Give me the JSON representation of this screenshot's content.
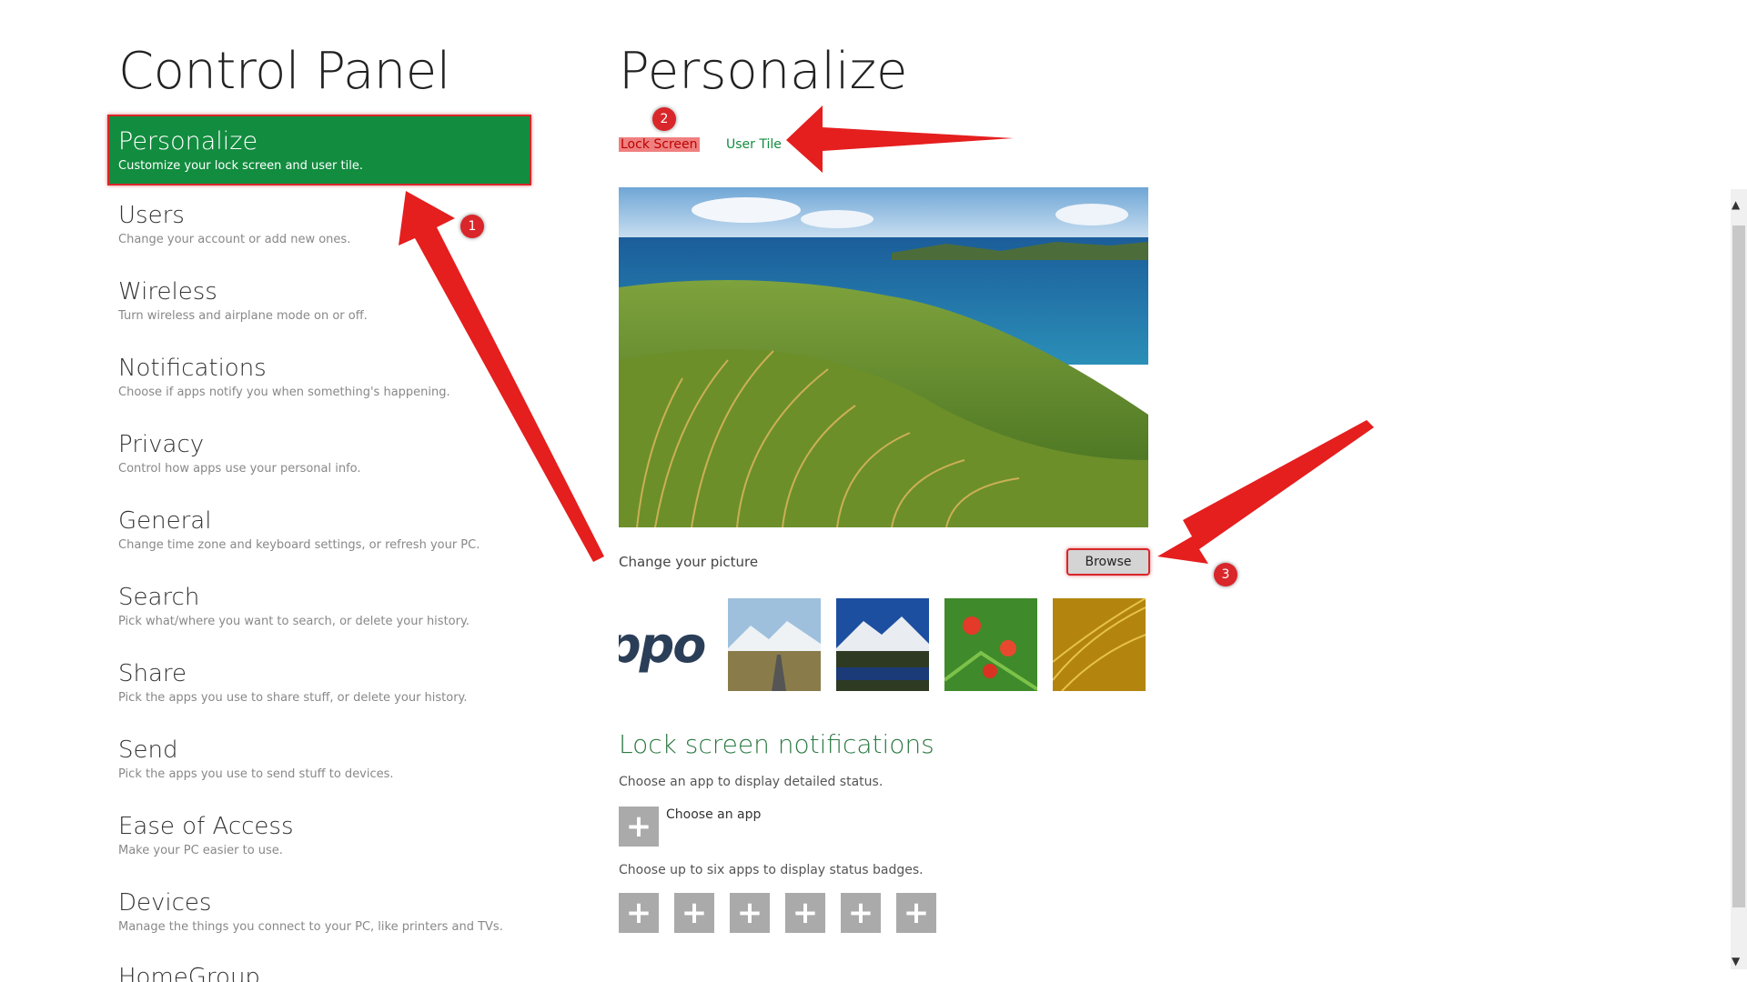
{
  "left": {
    "title": "Control Panel",
    "items": [
      {
        "name": "Personalize",
        "desc": "Customize your lock screen and user tile."
      },
      {
        "name": "Users",
        "desc": "Change your account or add new ones."
      },
      {
        "name": "Wireless",
        "desc": "Turn wireless and airplane mode on or off."
      },
      {
        "name": "Notifications",
        "desc": "Choose if apps notify you when something's happening."
      },
      {
        "name": "Privacy",
        "desc": "Control how apps use your personal info."
      },
      {
        "name": "General",
        "desc": "Change time zone and keyboard settings, or refresh your PC."
      },
      {
        "name": "Search",
        "desc": "Pick what/where you want to search, or delete your history."
      },
      {
        "name": "Share",
        "desc": "Pick the apps you use to share stuff, or delete your history."
      },
      {
        "name": "Send",
        "desc": "Pick the apps you use to send stuff to devices."
      },
      {
        "name": "Ease of Access",
        "desc": "Make your PC easier to use."
      },
      {
        "name": "Devices",
        "desc": "Manage the things you connect to your PC, like printers and TVs."
      },
      {
        "name": "HomeGroup",
        "desc": ""
      }
    ]
  },
  "right": {
    "title": "Personalize",
    "tabs": {
      "lock": "Lock Screen",
      "user": "User Tile"
    },
    "change_label": "Change your picture",
    "browse_label": "Browse",
    "thumb_text": "ppo",
    "notif_heading": "Lock screen notifications",
    "notif_desc1": "Choose an app to display detailed status.",
    "choose_app_label": "Choose an app",
    "notif_desc2": "Choose up to six apps to display status badges.",
    "plus_glyph": "+"
  },
  "annotations": {
    "b1": "1",
    "b2": "2",
    "b3": "3"
  },
  "colors": {
    "accent": "#128c3f",
    "highlight": "#d9262a",
    "heading_green": "#2c7a44"
  }
}
